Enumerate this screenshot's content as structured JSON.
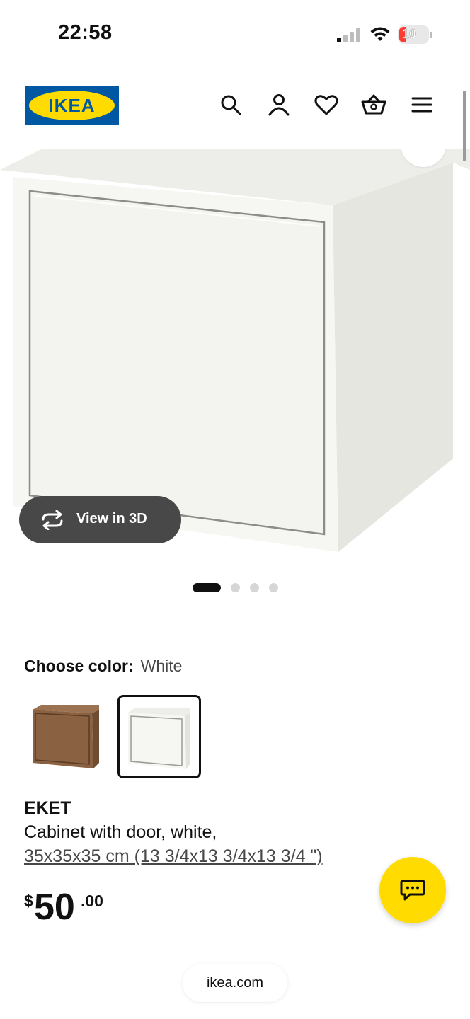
{
  "status_bar": {
    "time": "22:58",
    "battery": "10"
  },
  "header": {
    "logo_text": "IKEA",
    "icons": [
      "search-icon",
      "user-icon",
      "heart-icon",
      "basket-icon",
      "menu-icon"
    ]
  },
  "hero": {
    "view_3d_label": "View in 3D",
    "image_count": 4,
    "active_image": 1
  },
  "color": {
    "label": "Choose color:",
    "selected": "White",
    "options": [
      {
        "name": "Walnut effect",
        "color": "#8a6242"
      },
      {
        "name": "White",
        "color": "#f4f4ef"
      }
    ]
  },
  "product": {
    "name": "EKET",
    "description": "Cabinet with door, white,",
    "dimensions": "35x35x35 cm (13 3/4x13 3/4x13 3/4 \")",
    "price_currency": "$",
    "price_integer": "50",
    "price_decimal": ".00"
  },
  "browser": {
    "url": "ikea.com"
  },
  "colors": {
    "brand_blue": "#0058a3",
    "brand_yellow": "#ffdb00",
    "pill_dark": "#484848"
  }
}
